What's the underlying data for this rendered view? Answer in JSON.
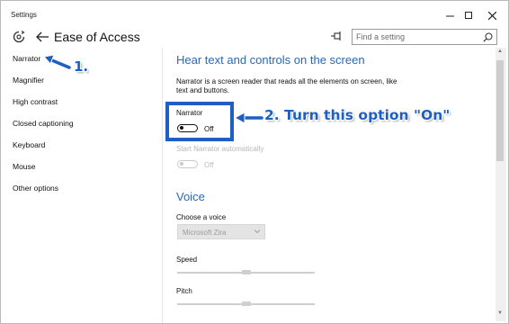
{
  "window": {
    "title": "Settings"
  },
  "header": {
    "page_title": "Ease of Access",
    "search_placeholder": "Find a setting"
  },
  "sidebar": {
    "items": [
      {
        "label": "Narrator"
      },
      {
        "label": "Magnifier"
      },
      {
        "label": "High contrast"
      },
      {
        "label": "Closed captioning"
      },
      {
        "label": "Keyboard"
      },
      {
        "label": "Mouse"
      },
      {
        "label": "Other options"
      }
    ]
  },
  "content": {
    "section1_title": "Hear text and controls on the screen",
    "description": "Narrator is a screen reader that reads all the elements on screen, like text and buttons.",
    "narrator": {
      "label": "Narrator",
      "state": "Off"
    },
    "auto_start": {
      "label": "Start Narrator automatically",
      "state": "Off"
    },
    "section2_title": "Voice",
    "choose_voice": {
      "label": "Choose a voice",
      "value": "Microsoft Zira"
    },
    "speed": {
      "label": "Speed",
      "level": 0.5
    },
    "pitch": {
      "label": "Pitch",
      "level": 0.5
    }
  },
  "annotations": {
    "step1": "1.",
    "step2": "2. Turn this option \"On\"",
    "color": "#1f5fc1"
  },
  "colors": {
    "accent": "#2b68b4",
    "annotation": "#1f5fc1"
  }
}
